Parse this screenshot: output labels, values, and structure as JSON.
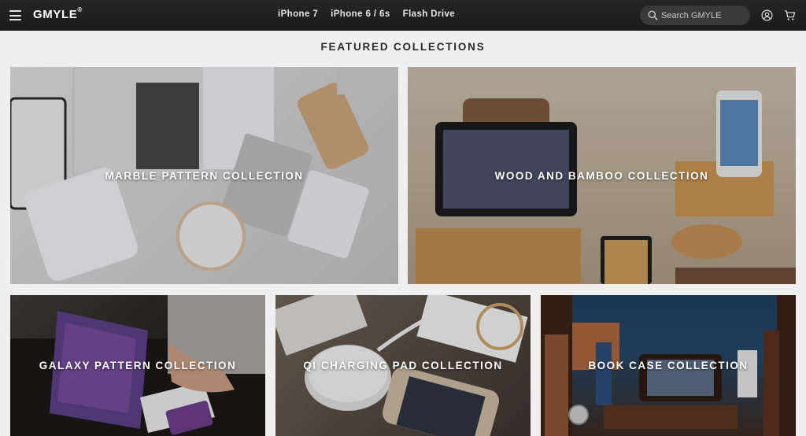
{
  "header": {
    "brand": "GMYLE",
    "brand_mark": "®",
    "nav": [
      "iPhone 7",
      "iPhone 6 / 6s",
      "Flash Drive"
    ],
    "search_placeholder": "Search GMYLE",
    "icons": [
      "menu-icon",
      "search-icon",
      "account-icon",
      "cart-icon"
    ]
  },
  "main": {
    "title": "FEATURED COLLECTIONS",
    "collections": [
      "MARBLE PATTERN COLLECTION",
      "WOOD AND BAMBOO COLLECTION",
      "GALAXY PATTERN COLLECTION",
      "QI CHARGING PAD COLLECTION",
      "BOOK CASE COLLECTION"
    ]
  }
}
